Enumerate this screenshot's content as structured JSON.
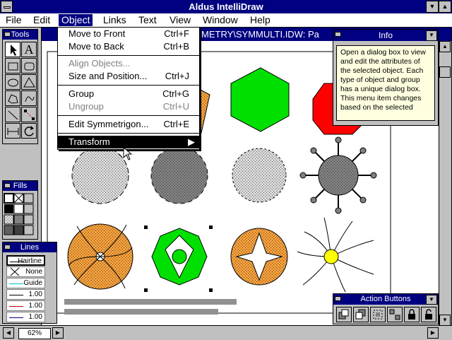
{
  "app": {
    "title": "Aldus IntelliDraw"
  },
  "menubar": {
    "items": [
      {
        "label": "File"
      },
      {
        "label": "Edit"
      },
      {
        "label": "Object"
      },
      {
        "label": "Links"
      },
      {
        "label": "Text"
      },
      {
        "label": "View"
      },
      {
        "label": "Window"
      },
      {
        "label": "Help"
      }
    ]
  },
  "document": {
    "title_visible": "METRY\\SYMMULTI.IDW: Pa",
    "zoom": "62%"
  },
  "object_menu": {
    "items": [
      {
        "label": "Move to Front",
        "shortcut": "Ctrl+F",
        "enabled": true
      },
      {
        "label": "Move to Back",
        "shortcut": "Ctrl+B",
        "enabled": true
      },
      {
        "label": "Align Objects...",
        "shortcut": "",
        "enabled": false
      },
      {
        "label": "Size and Position...",
        "shortcut": "Ctrl+J",
        "enabled": true
      },
      {
        "label": "Group",
        "shortcut": "Ctrl+G",
        "enabled": true
      },
      {
        "label": "Ungroup",
        "shortcut": "Ctrl+U",
        "enabled": false
      },
      {
        "label": "Edit Symmetrigon...",
        "shortcut": "Ctrl+E",
        "enabled": true
      },
      {
        "label": "Transform",
        "shortcut": "",
        "enabled": true,
        "highlighted": true,
        "submenu": true
      }
    ]
  },
  "tools_palette": {
    "title": "Tools",
    "text_tool_glyph": "A"
  },
  "fills_palette": {
    "title": "Fills"
  },
  "lines_palette": {
    "title": "Lines",
    "rows": [
      {
        "label": "Hairline"
      },
      {
        "label": "None"
      },
      {
        "label": "Guide",
        "color": "#00c0c0"
      },
      {
        "label": "1.00",
        "color": "#000000"
      },
      {
        "label": "1.00",
        "color": "#c00000"
      },
      {
        "label": "1.00",
        "color": "#000080"
      }
    ]
  },
  "info_panel": {
    "title": "Info",
    "text": "Open a dialog box to view and edit the attributes of the selected object. Each type of object and group has a unique dialog box. This menu item changes based on the selected"
  },
  "action_buttons": {
    "title": "Action Buttons"
  },
  "colors": {
    "titlebar": "#000080",
    "desktop": "#c0c0c0",
    "green": "#00e000",
    "red": "#ff0000",
    "orange": "#f0a040",
    "gray": "#808080",
    "yellow": "#ffff00"
  },
  "icons": [
    "system-menu-icon",
    "minimize-icon",
    "maximize-icon",
    "arrow-tool-icon",
    "text-tool-icon",
    "rectangle-tool-icon",
    "rounded-rect-tool-icon",
    "ellipse-tool-icon",
    "triangle-tool-icon",
    "polygon-tool-icon",
    "freehand-tool-icon",
    "line-tool-icon",
    "connector-tool-icon",
    "dimension-tool-icon",
    "rotate-tool-icon",
    "lock-icon",
    "unlock-icon"
  ]
}
